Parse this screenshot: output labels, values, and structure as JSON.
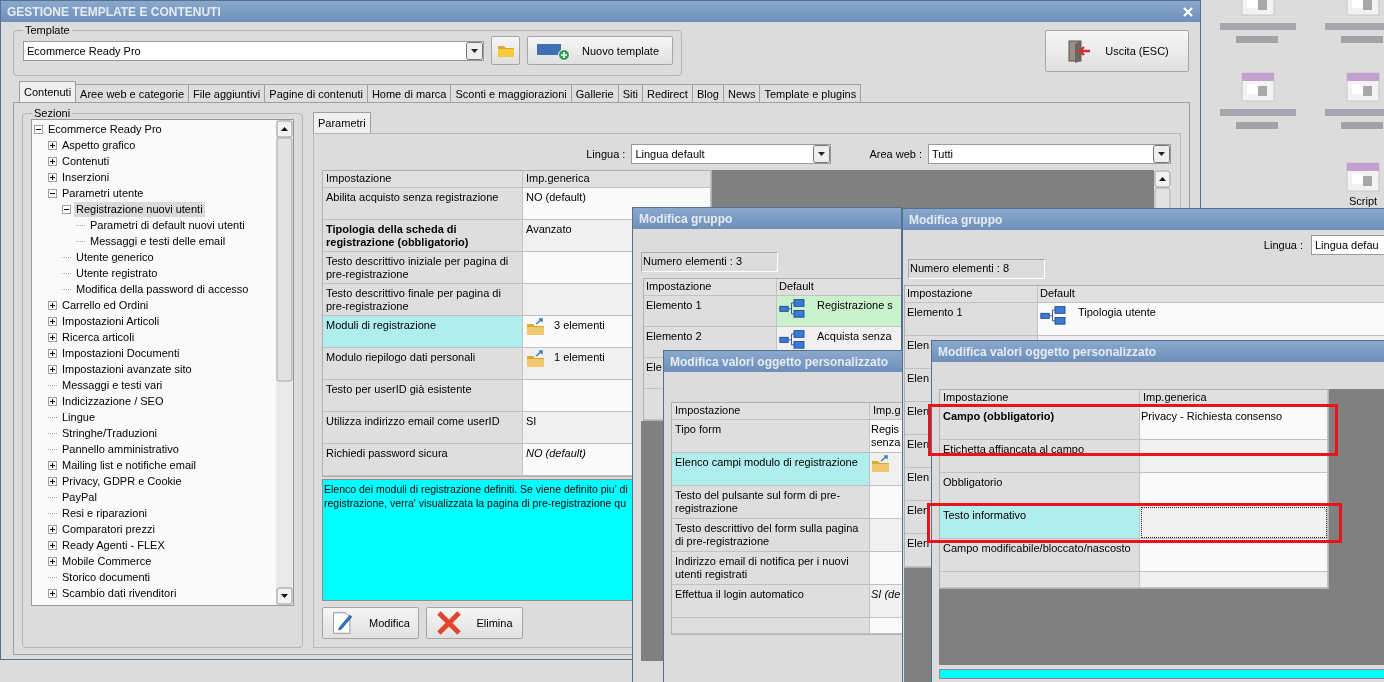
{
  "main_window": {
    "title": "GESTIONE TEMPLATE E CONTENUTI"
  },
  "template": {
    "label": "Template",
    "value": "Ecommerce Ready Pro",
    "new_button": "Nuovo template",
    "exit_button": "Uscita (ESC)"
  },
  "tabs": [
    {
      "label": "Contenuti",
      "selected": true
    },
    {
      "label": "Aree web e categorie",
      "selected": false
    },
    {
      "label": "File aggiuntivi",
      "selected": false
    },
    {
      "label": "Pagine di contenuti",
      "selected": false
    },
    {
      "label": "Home di marca",
      "selected": false
    },
    {
      "label": "Sconti e maggiorazioni",
      "selected": false
    },
    {
      "label": "Gallerie",
      "selected": false
    },
    {
      "label": "Siti",
      "selected": false
    },
    {
      "label": "Redirect",
      "selected": false
    },
    {
      "label": "Blog",
      "selected": false
    },
    {
      "label": "News",
      "selected": false
    },
    {
      "label": "Template e plugins",
      "selected": false
    }
  ],
  "sections": {
    "label": "Sezioni",
    "tree": [
      {
        "label": "Ecommerce Ready Pro",
        "kind": "node",
        "expanded": true,
        "selected": false,
        "children": [
          {
            "label": "Aspetto grafico",
            "kind": "node",
            "expanded": false,
            "selected": false
          },
          {
            "label": "Contenuti",
            "kind": "node",
            "expanded": false,
            "selected": false
          },
          {
            "label": "Inserzioni",
            "kind": "node",
            "expanded": false,
            "selected": false
          },
          {
            "label": "Parametri utente",
            "kind": "node",
            "expanded": true,
            "selected": false,
            "children": [
              {
                "label": "Registrazione nuovi utenti",
                "kind": "node",
                "expanded": true,
                "selected": true,
                "children": [
                  {
                    "label": "Parametri di default nuovi utenti",
                    "kind": "leaf",
                    "selected": false
                  },
                  {
                    "label": "Messaggi e testi delle email",
                    "kind": "leaf",
                    "selected": false
                  }
                ]
              },
              {
                "label": "Utente generico",
                "kind": "leaf",
                "selected": false
              },
              {
                "label": "Utente registrato",
                "kind": "leaf",
                "selected": false
              },
              {
                "label": "Modifica della password di accesso",
                "kind": "leaf",
                "selected": false
              }
            ]
          },
          {
            "label": "Carrello ed Ordini",
            "kind": "node",
            "expanded": false,
            "selected": false
          },
          {
            "label": "Impostazioni Articoli",
            "kind": "node",
            "expanded": false,
            "selected": false
          },
          {
            "label": "Ricerca articoli",
            "kind": "node",
            "expanded": false,
            "selected": false
          },
          {
            "label": "Impostazioni Documenti",
            "kind": "node",
            "expanded": false,
            "selected": false
          },
          {
            "label": "Impostazioni avanzate sito",
            "kind": "node",
            "expanded": false,
            "selected": false
          },
          {
            "label": "Messaggi e testi vari",
            "kind": "leaf",
            "selected": false
          },
          {
            "label": "Indicizzazione / SEO",
            "kind": "node",
            "expanded": false,
            "selected": false
          },
          {
            "label": "Lingue",
            "kind": "leaf",
            "selected": false
          },
          {
            "label": "Stringhe/Traduzioni",
            "kind": "leaf",
            "selected": false
          },
          {
            "label": "Pannello amministrativo",
            "kind": "leaf",
            "selected": false
          },
          {
            "label": "Mailing list e notifiche email",
            "kind": "node",
            "expanded": false,
            "selected": false
          },
          {
            "label": "Privacy, GDPR e Cookie",
            "kind": "node",
            "expanded": false,
            "selected": false
          },
          {
            "label": "PayPal",
            "kind": "leaf",
            "selected": false
          },
          {
            "label": "Resi e riparazioni",
            "kind": "leaf",
            "selected": false
          },
          {
            "label": "Comparatori prezzi",
            "kind": "node",
            "expanded": false,
            "selected": false
          },
          {
            "label": "Ready Agenti - FLEX",
            "kind": "node",
            "expanded": false,
            "selected": false
          },
          {
            "label": "Mobile Commerce",
            "kind": "node",
            "expanded": false,
            "selected": false
          },
          {
            "label": "Storico documenti",
            "kind": "leaf",
            "selected": false
          },
          {
            "label": "Scambio dati rivenditori",
            "kind": "node",
            "expanded": false,
            "selected": false
          }
        ]
      }
    ]
  },
  "parameters": {
    "tab": "Parametri",
    "language_label": "Lingua :",
    "language": "Lingua default",
    "area_label": "Area web :",
    "area": "Tutti",
    "columns": [
      "Impostazione",
      "Imp.generica"
    ],
    "rows": [
      {
        "setting": "Abilita acquisto senza registrazione",
        "kind": "text",
        "value": "NO (default)",
        "selected": false
      },
      {
        "setting": "Tipologia della scheda di registrazione (obbligatorio)",
        "kind": "text",
        "value": "Avanzato",
        "bold": true,
        "selected": false
      },
      {
        "setting": "Testo descrittivo iniziale per pagina di pre-registrazione",
        "kind": "empty",
        "selected": false
      },
      {
        "setting": "Testo descrittivo finale per pagina di pre-registrazione",
        "kind": "empty",
        "selected": false
      },
      {
        "setting": "Moduli di registrazione",
        "kind": "items",
        "value": "3 elementi",
        "selected": true
      },
      {
        "setting": "Modulo riepilogo dati personali",
        "kind": "items",
        "value": "1 elementi",
        "selected": false
      },
      {
        "setting": "Testo per userID già esistente",
        "kind": "empty",
        "selected": false
      },
      {
        "setting": "Utilizza indirizzo email come userID",
        "kind": "text",
        "value": "SI",
        "selected": false
      },
      {
        "setting": "Richiedi password sicura",
        "kind": "text",
        "value": "NO (default)",
        "italic": true,
        "selected": false
      }
    ],
    "description": [
      "Elenco dei moduli di registrazione definiti. Se viene definito piu' di",
      "registrazione, verra' visualizzata la pagina di pre-registrazione qu"
    ],
    "buttons": [
      {
        "label": "Modifica",
        "kind": "edit"
      },
      {
        "label": "Elimina",
        "kind": "delete"
      }
    ]
  },
  "group_dialogs": [
    {
      "title": "Modifica gruppo",
      "count": "Numero elementi : 3",
      "columns": [
        "Impostazione",
        "Default"
      ],
      "rows": [
        {
          "setting": "Elemento 1",
          "kind": "node",
          "value": "Registrazione s",
          "selected": true
        },
        {
          "setting": "Elemento 2",
          "kind": "node",
          "value": "Acquista senza",
          "selected": false
        },
        {
          "setting": "Ele",
          "kind": "empty",
          "selected": false
        },
        {
          "kind": "blank"
        }
      ]
    },
    {
      "title": "Modifica gruppo",
      "language_label": "Lingua :",
      "language": "Lingua defau",
      "count": "Numero elementi : 8",
      "columns": [
        "Impostazione",
        "Default"
      ],
      "rows": [
        {
          "setting": "Elemento 1",
          "kind": "node",
          "value": "Tipologia utente",
          "selected": false
        },
        {
          "setting": "Elen",
          "kind": "empty",
          "selected": false
        },
        {
          "setting": "Elen",
          "kind": "empty",
          "selected": false
        },
        {
          "setting": "Elen",
          "kind": "empty",
          "selected": false
        },
        {
          "setting": "Elen",
          "kind": "empty",
          "selected": false
        },
        {
          "setting": "Elen",
          "kind": "empty",
          "selected": false
        },
        {
          "setting": "Elen",
          "kind": "empty",
          "selected": false
        },
        {
          "setting": "Elen",
          "kind": "empty",
          "selected": false
        }
      ]
    }
  ],
  "value_dialogs": [
    {
      "title": "Modifica valori oggetto personalizzato",
      "columns": [
        "Impostazione",
        "Imp.g"
      ],
      "rows": [
        {
          "setting": "Tipo form",
          "kind": "text",
          "value": "Regis senza",
          "selected": false
        },
        {
          "setting": "Elenco campi modulo di registrazione",
          "kind": "items",
          "selected": true
        },
        {
          "setting": "Testo del pulsante sul form di pre-registrazione",
          "kind": "empty",
          "selected": false
        },
        {
          "setting": "Testo descrittivo del form sulla pagina di pre-registrazione",
          "kind": "empty",
          "selected": false
        },
        {
          "setting": "Indirizzo email di notifica per i nuovi utenti registrati",
          "kind": "empty",
          "selected": false
        },
        {
          "setting": "Effettua il login automatico",
          "kind": "text",
          "value": "SI (de",
          "italic": true,
          "selected": false
        },
        {
          "kind": "blank"
        }
      ]
    },
    {
      "title": "Modifica valori oggetto personalizzato",
      "columns": [
        "Impostazione",
        "Imp.generica"
      ],
      "rows": [
        {
          "setting": "Campo (obbligatorio)",
          "kind": "text",
          "value": "Privacy - Richiesta consenso",
          "bold": true,
          "selected": false,
          "focused": false
        },
        {
          "setting": "Etichetta affiancata al campo",
          "kind": "empty",
          "selected": false,
          "focused": false
        },
        {
          "setting": "Obbligatorio",
          "kind": "empty",
          "selected": false,
          "focused": false
        },
        {
          "setting": "Testo informativo",
          "kind": "empty",
          "selected": true,
          "focused": true
        },
        {
          "setting": "Campo modificabile/bloccato/nascosto",
          "kind": "empty",
          "selected": false,
          "focused": false
        },
        {
          "kind": "blank"
        }
      ]
    }
  ],
  "desktop_icons": [
    {
      "kind": "blurred"
    },
    {
      "kind": "blurred"
    },
    {
      "kind": "blurred"
    },
    {
      "kind": "blurred"
    },
    {
      "kind": "labeled",
      "label": "Script"
    }
  ]
}
